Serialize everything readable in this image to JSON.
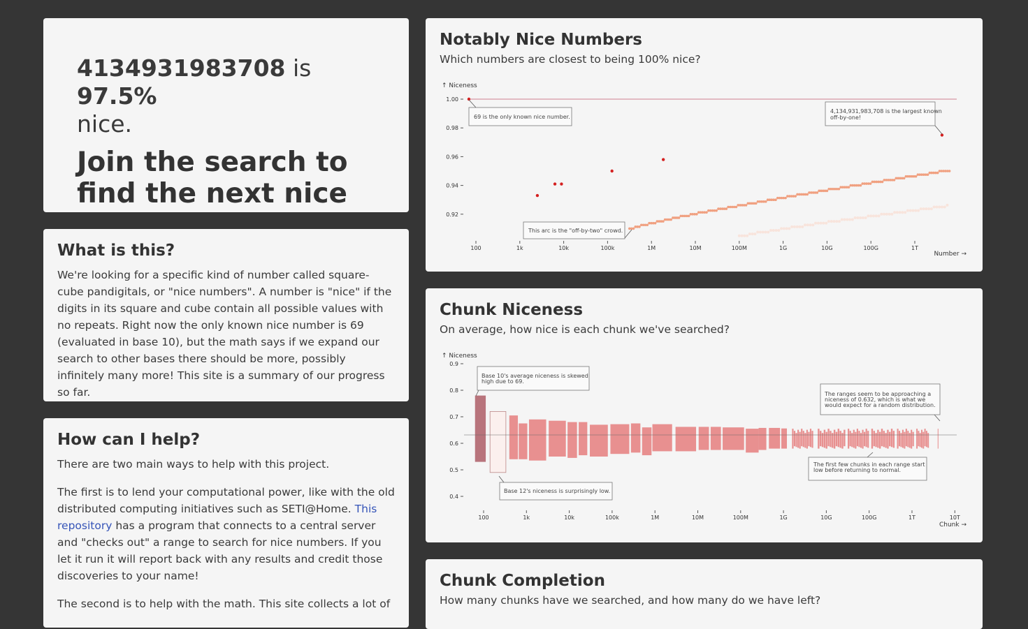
{
  "hero": {
    "number": "4134931983708",
    "is_word": "is",
    "percent": "97.5%",
    "nice_word": "nice.",
    "cta": "Join the search to find the next nice number."
  },
  "about": {
    "title": "What is this?",
    "body": "We're looking for a specific kind of number called square-cube pandigitals, or \"nice numbers\". A number is \"nice\" if the digits in its square and cube contain all possible values with no repeats. Right now the only known nice number is 69 (evaluated in base 10), but the math says if we expand our search to other bases there should be more, possibly infinitely many more! This site is a summary of our progress so far."
  },
  "help": {
    "title": "How can I help?",
    "p1": "There are two main ways to help with this project.",
    "p2_before": "The first is to lend your computational power, like with the old distributed computing initiatives such as SETI@Home. ",
    "p2_link": "This repository",
    "p2_after": " has a program that connects to a central server and \"checks out\" a range to search for nice numbers. If you let it run it will report back with any results and credit those discoveries to your name!",
    "p3": "The second is to help with the math. This site collects a lot of"
  },
  "nice_chart": {
    "title": "Notably Nice Numbers",
    "subtitle": "Which numbers are closest to being 100% nice?",
    "ylabel": "↑ Niceness",
    "xlabel": "Number →",
    "yticks": [
      "1.00",
      "0.98",
      "0.96",
      "0.94",
      "0.92"
    ],
    "xticks": [
      "100",
      "1k",
      "10k",
      "100k",
      "1M",
      "10M",
      "100M",
      "1G",
      "10G",
      "100G",
      "1T"
    ],
    "annotation_69": "69 is the only known nice number.",
    "annotation_largest_1": "4,134,931,983,708 is the largest known",
    "annotation_largest_2": "off-by-one!",
    "annotation_arc": "This arc is the \"off-by-two\" crowd.",
    "colors": {
      "highlight": "#d42020",
      "main": "#f0a080",
      "faint": "#f8e4dc",
      "target_line": "#d08090"
    }
  },
  "chunk_chart": {
    "title": "Chunk Niceness",
    "subtitle": "On average, how nice is each chunk we've searched?",
    "ylabel": "↑ Niceness",
    "xlabel": "Chunk →",
    "yticks": [
      "0.9",
      "0.8",
      "0.7",
      "0.6",
      "0.5",
      "0.4"
    ],
    "xticks": [
      "100",
      "1k",
      "10k",
      "100k",
      "1M",
      "10M",
      "100M",
      "1G",
      "10G",
      "100G",
      "1T",
      "10T"
    ],
    "annotation_base10_1": "Base 10's average niceness is skewed",
    "annotation_base10_2": "high due to 69.",
    "annotation_base12": "Base 12's niceness is surprisingly low.",
    "annotation_range_1": "The ranges seem to be approaching a",
    "annotation_range_2": "niceness of 0.632, which is what we",
    "annotation_range_3": "would expect for a random distribution.",
    "annotation_first_1": "The first few chunks in each range start",
    "annotation_first_2": "low before returning to normal.",
    "colors": {
      "bar": "#e89090",
      "base10": "#b8747c",
      "base12": "#fbf0ee"
    }
  },
  "completion": {
    "title": "Chunk Completion",
    "subtitle": "How many chunks have we searched, and how many do we have left?"
  }
}
